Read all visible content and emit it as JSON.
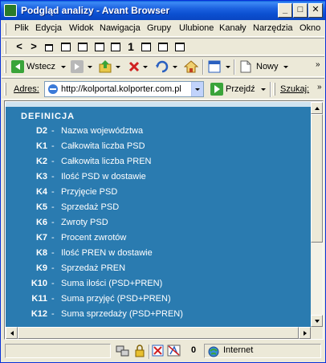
{
  "window": {
    "title": "Podgląd analizy - Avant Browser",
    "minimize": "_",
    "maximize": "□",
    "close": "✕"
  },
  "menu": [
    "Plik",
    "Edycja",
    "Widok",
    "Nawigacja",
    "Grupy",
    "Ulubione",
    "Kanały",
    "Narzędzia",
    "Okno"
  ],
  "toolbar1": {
    "icons": [
      "back-arrow-icon",
      "forward-arrow-icon",
      "cascade-windows-icon",
      "tile-horizontal-icon",
      "tile-vertical-icon",
      "close-all-icon",
      "single-window-icon",
      "minimize-all-icon",
      "restore-icon",
      "close-window-icon"
    ],
    "single_window_label": "1"
  },
  "toolbar2": {
    "back_label": "Wstecz",
    "new_label": "Nowy",
    "icons": [
      "back-icon",
      "forward-icon",
      "up-icon",
      "stop-icon",
      "refresh-icon",
      "home-icon",
      "view-icon",
      "new-page-icon"
    ]
  },
  "address": {
    "label": "Adres:",
    "url": "http://kolportal.kolporter.com.pl",
    "go_label": "Przejdź",
    "search_label": "Szukaj:"
  },
  "definitions": {
    "title": "DEFINICJA",
    "rows": [
      {
        "code": "D2",
        "desc": "Nazwa województwa"
      },
      {
        "code": "K1",
        "desc": "Całkowita liczba PSD"
      },
      {
        "code": "K2",
        "desc": "Całkowita liczba PREN"
      },
      {
        "code": "K3",
        "desc": "Ilość PSD w dostawie"
      },
      {
        "code": "K4",
        "desc": "Przyjęcie PSD"
      },
      {
        "code": "K5",
        "desc": "Sprzedaż PSD"
      },
      {
        "code": "K6",
        "desc": "Zwroty PSD"
      },
      {
        "code": "K7",
        "desc": "Procent zwrotów"
      },
      {
        "code": "K8",
        "desc": "Ilość PREN w dostawie"
      },
      {
        "code": "K9",
        "desc": "Sprzedaż PREN"
      },
      {
        "code": "K10",
        "desc": "Suma ilości (PSD+PREN)"
      },
      {
        "code": "K11",
        "desc": "Suma przyjęć (PSD+PREN)"
      },
      {
        "code": "K12",
        "desc": "Suma sprzedaży (PSD+PREN)"
      }
    ],
    "dash": "-"
  },
  "status": {
    "count": "0",
    "zone": "Internet"
  },
  "colors": {
    "content_bg": "#2a7bb0",
    "title_bar": "#0a46c2"
  }
}
